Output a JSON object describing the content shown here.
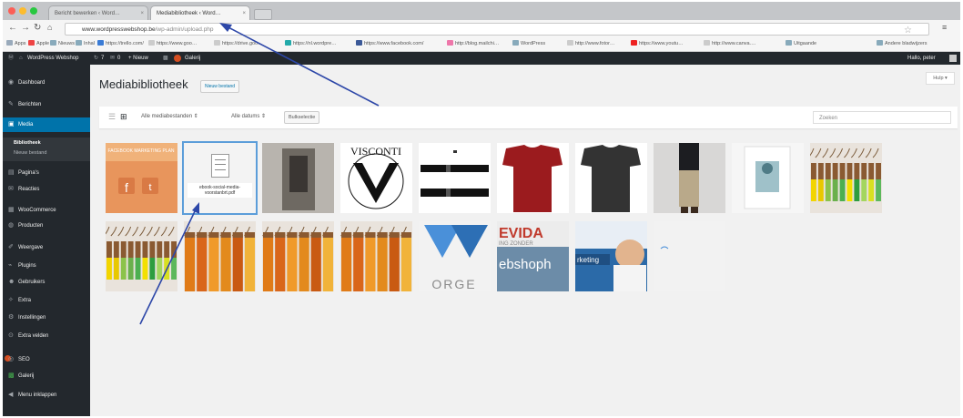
{
  "browser": {
    "tabs": [
      {
        "label": "Bericht bewerken ‹ Word…",
        "active": false
      },
      {
        "label": "Mediabibliotheek ‹ Word…",
        "active": true
      }
    ],
    "url_host": "www.wordpresswebshop.be",
    "url_path": "/wp-admin/upload.php",
    "bookmarks": [
      "Apps",
      "Apple",
      "Nieuws",
      "Inhal",
      "https://trello.com/",
      "https://www.goo…",
      "https://drive.goo…",
      "https://nl.wordpre…",
      "https://www.facebook.com/",
      "http://blog.mailchi…",
      "WordPress",
      "http://www.fotor…",
      "https://www.youtu…",
      "http://www.canva.…",
      "Uitgaande",
      "Andere bladwijzers"
    ]
  },
  "adminbar": {
    "site": "WordPress Webshop",
    "updates": "7",
    "comments": "0",
    "new": "+ Nieuw",
    "gallery": "Galerij",
    "greeting": "Hallo, peter"
  },
  "sidebar": {
    "items": [
      {
        "label": "Dashboard",
        "icon": "dashboard-icon",
        "glyph": "◉"
      },
      {
        "label": "Berichten",
        "icon": "pin-icon",
        "glyph": "✎"
      },
      {
        "label": "Media",
        "icon": "media-icon",
        "glyph": "▣",
        "current": true
      },
      {
        "label": "Pagina's",
        "icon": "pages-icon",
        "glyph": "▤"
      },
      {
        "label": "Reacties",
        "icon": "comments-icon",
        "glyph": "✉"
      },
      {
        "label": "WooCommerce",
        "icon": "woocommerce-icon",
        "glyph": "▦"
      },
      {
        "label": "Producten",
        "icon": "products-icon",
        "glyph": "◍"
      },
      {
        "label": "Weergave",
        "icon": "appearance-icon",
        "glyph": "✐"
      },
      {
        "label": "Plugins",
        "icon": "plugins-icon",
        "glyph": "⌁"
      },
      {
        "label": "Gebruikers",
        "icon": "users-icon",
        "glyph": "☻"
      },
      {
        "label": "Extra",
        "icon": "tools-icon",
        "glyph": "✧"
      },
      {
        "label": "Instellingen",
        "icon": "settings-icon",
        "glyph": "⚙"
      },
      {
        "label": "Extra velden",
        "icon": "fields-icon",
        "glyph": "⊙"
      },
      {
        "label": "SEO",
        "icon": "seo-icon",
        "glyph": "◎",
        "badge": true
      },
      {
        "label": "Galerij",
        "icon": "gallery-icon",
        "glyph": "▩"
      },
      {
        "label": "Menu inklappen",
        "icon": "collapse-icon",
        "glyph": "◀"
      }
    ],
    "submenu": [
      "Bibliotheek",
      "Nieuw bestand"
    ]
  },
  "main": {
    "title": "Mediabibliotheek",
    "add_new": "Nieuw bestand",
    "help": "Hulp ▾",
    "filter_type": "Alle mediabestanden ⇕",
    "filter_date": "Alle datums ⇕",
    "bulk_select": "Bulkselectie",
    "search_placeholder": "Zoeken",
    "selected_file": "ebook-social-media-voorstanbrt.pdf"
  },
  "tiles": [
    {
      "kind": "social",
      "label": "FACEBOOK MARKETING PLAN"
    },
    {
      "kind": "doc",
      "label": "ebook-social-media-voorstanbrt.pdf",
      "selected": true
    },
    {
      "kind": "photo-dark"
    },
    {
      "kind": "visconti",
      "label": "VISCONTI"
    },
    {
      "kind": "pens"
    },
    {
      "kind": "shirt",
      "color": "#9b1b1e"
    },
    {
      "kind": "shirt",
      "color": "#333333"
    },
    {
      "kind": "man"
    },
    {
      "kind": "print"
    },
    {
      "kind": "hangers"
    },
    {
      "kind": "hangers"
    },
    {
      "kind": "hangers-orange"
    },
    {
      "kind": "hangers-orange"
    },
    {
      "kind": "hangers-orange"
    },
    {
      "kind": "vorge",
      "label": "ORGE"
    },
    {
      "kind": "evida",
      "label": "EVIDA",
      "sub": "ebshoph",
      "small": "ING ZONDER"
    },
    {
      "kind": "surprised",
      "label": "rketing"
    },
    {
      "kind": "blank"
    }
  ],
  "colors": {
    "admin_dark": "#23282d",
    "accent": "#0073aa",
    "arrow": "#2d47a8"
  }
}
